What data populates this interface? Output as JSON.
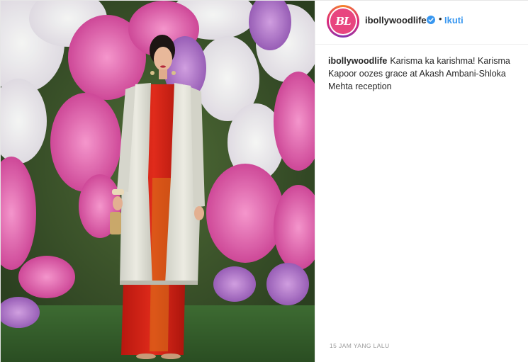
{
  "post": {
    "author": {
      "username": "ibollywoodlife",
      "avatar_text": "BL",
      "verified": true,
      "verified_icon": "verified-badge-icon"
    },
    "header": {
      "separator": "•",
      "follow_label": "Ikuti"
    },
    "caption": {
      "username": "ibollywoodlife",
      "text": "Karisma ka karishma! Karisma Kapoor oozes grace at Akash Ambani-Shloka Mehta reception"
    },
    "timestamp": "15 JAM YANG LALU",
    "image": {
      "description_icon": "photo-image"
    }
  },
  "colors": {
    "accent": "#3897f0",
    "avatar_bg": "#e8457f",
    "text": "#262626",
    "muted": "#999999"
  }
}
